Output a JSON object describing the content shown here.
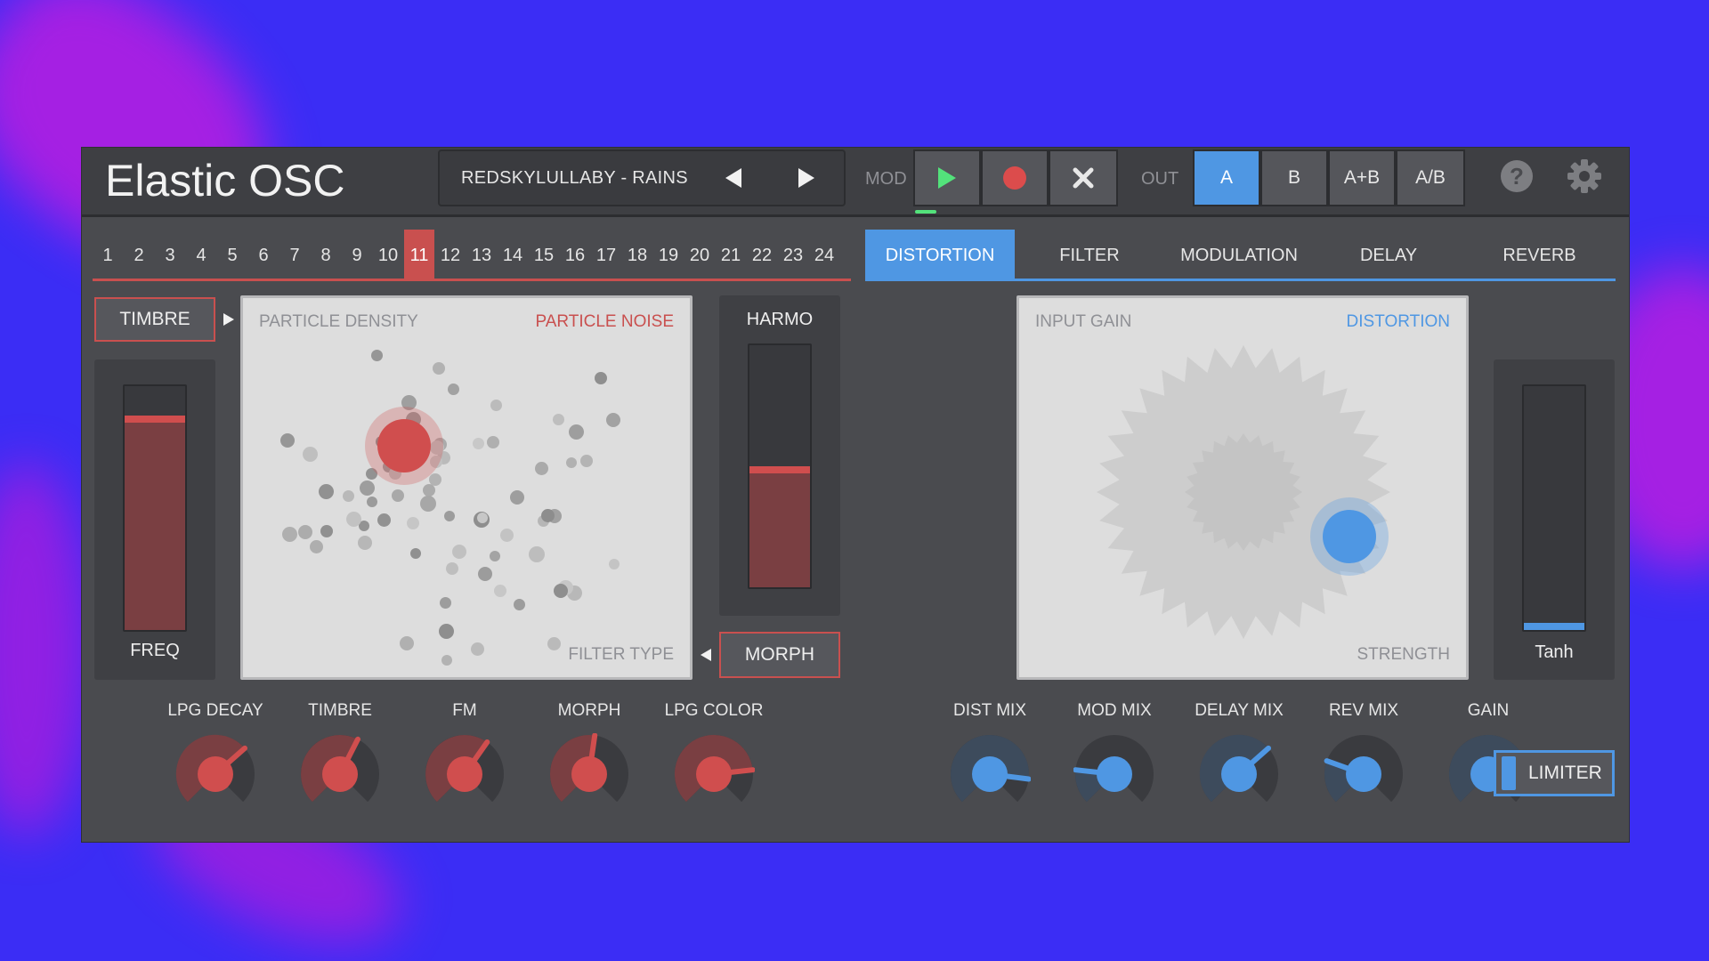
{
  "app": {
    "title": "Elastic OSC"
  },
  "preset": {
    "name": "REDSKYLULLABY - RAINS",
    "prev_icon": "chevron-left-icon",
    "next_icon": "chevron-right-icon"
  },
  "mod": {
    "label": "MOD",
    "play_icon": "play-icon",
    "record_icon": "record-icon",
    "clear_icon": "close-icon",
    "play_color": "#53e27b",
    "record_color": "#dc4c4c"
  },
  "out": {
    "label": "OUT",
    "options": [
      "A",
      "B",
      "A+B",
      "A/B"
    ],
    "selected": "A"
  },
  "header_icons": {
    "help": "?",
    "settings_icon": "gear-icon"
  },
  "steps": {
    "items": [
      "1",
      "2",
      "3",
      "4",
      "5",
      "6",
      "7",
      "8",
      "9",
      "10",
      "11",
      "12",
      "13",
      "14",
      "15",
      "16",
      "17",
      "18",
      "19",
      "20",
      "21",
      "22",
      "23",
      "24"
    ],
    "active": "11",
    "accent": "#c9504f"
  },
  "tabs": {
    "items": [
      "DISTORTION",
      "FILTER",
      "MODULATION",
      "DELAY",
      "REVERB"
    ],
    "active": "DISTORTION",
    "accent": "#4f97e3"
  },
  "left": {
    "timbre_button": "TIMBRE",
    "freq_slider": {
      "label": "FREQ",
      "value": 0.88
    },
    "pad": {
      "top_left": "PARTICLE DENSITY",
      "top_right": "PARTICLE NOISE",
      "bottom_right": "FILTER TYPE",
      "puck_x": 0.36,
      "puck_y": 0.39
    },
    "harmo_slider": {
      "label": "HARMO",
      "value": 0.5
    },
    "morph_button": "MORPH"
  },
  "right": {
    "pad": {
      "top_left": "INPUT GAIN",
      "top_right": "DISTORTION",
      "bottom_right": "STRENGTH",
      "puck_x": 0.74,
      "puck_y": 0.63
    },
    "tanh_slider": {
      "label": "Tanh",
      "value": 0.02
    }
  },
  "knobs_left": [
    {
      "label": "LPG DECAY",
      "value": 0.68
    },
    {
      "label": "TIMBRE",
      "value": 0.6
    },
    {
      "label": "FM",
      "value": 0.63
    },
    {
      "label": "MORPH",
      "value": 0.53
    },
    {
      "label": "LPG COLOR",
      "value": 0.81
    }
  ],
  "knobs_right": [
    {
      "label": "DIST MIX",
      "value": 0.86
    },
    {
      "label": "MOD MIX",
      "value": 0.19
    },
    {
      "label": "DELAY MIX",
      "value": 0.68
    },
    {
      "label": "REV MIX",
      "value": 0.24
    },
    {
      "label": "GAIN",
      "value": 0.78
    }
  ],
  "limiter": {
    "label": "LIMITER",
    "on": true
  }
}
